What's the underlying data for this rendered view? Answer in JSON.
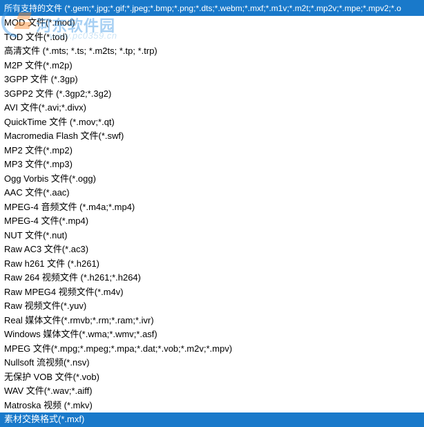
{
  "watermark": {
    "brand": "河东软件园",
    "url": "www.pc0359.cn"
  },
  "header": {
    "label": "所有支持的文件 (*.gem;*.jpg;*.gif;*.jpeg;*.bmp;*.png;*.dts;*.webm;*.mxf;*.m1v;*.m2t;*.mp2v;*.mpe;*.mpv2;*.o"
  },
  "filetypes": [
    {
      "label": "MOD 文件(*.mod)",
      "highlighted": false
    },
    {
      "label": "TOD 文件(*.tod)",
      "highlighted": false
    },
    {
      "label": "高清文件 (*.mts; *.ts; *.m2ts; *.tp; *.trp)",
      "highlighted": false
    },
    {
      "label": "M2P 文件(*.m2p)",
      "highlighted": false
    },
    {
      "label": "3GPP 文件 (*.3gp)",
      "highlighted": false
    },
    {
      "label": "3GPP2 文件 (*.3gp2;*.3g2)",
      "highlighted": false
    },
    {
      "label": "AVI 文件(*.avi;*.divx)",
      "highlighted": false
    },
    {
      "label": "QuickTime 文件 (*.mov;*.qt)",
      "highlighted": false
    },
    {
      "label": "Macromedia Flash 文件(*.swf)",
      "highlighted": false
    },
    {
      "label": "MP2 文件(*.mp2)",
      "highlighted": false
    },
    {
      "label": "MP3 文件(*.mp3)",
      "highlighted": false
    },
    {
      "label": "Ogg  Vorbis 文件(*.ogg)",
      "highlighted": false
    },
    {
      "label": "AAC 文件(*.aac)",
      "highlighted": false
    },
    {
      "label": "MPEG-4 音频文件 (*.m4a;*.mp4)",
      "highlighted": false
    },
    {
      "label": "MPEG-4 文件(*.mp4)",
      "highlighted": false
    },
    {
      "label": "NUT 文件(*.nut)",
      "highlighted": false
    },
    {
      "label": "Raw AC3 文件(*.ac3)",
      "highlighted": false
    },
    {
      "label": "Raw h261 文件 (*.h261)",
      "highlighted": false
    },
    {
      "label": "Raw 264 视频文件 (*.h261;*.h264)",
      "highlighted": false
    },
    {
      "label": "Raw MPEG4 视频文件(*.m4v)",
      "highlighted": false
    },
    {
      "label": "Raw 视频文件(*.yuv)",
      "highlighted": false
    },
    {
      "label": "Real 媒体文件(*.rmvb;*.rm;*.ram;*.ivr)",
      "highlighted": false
    },
    {
      "label": "Windows 媒体文件(*.wma;*.wmv;*.asf)",
      "highlighted": false
    },
    {
      "label": "MPEG 文件(*.mpg;*.mpeg;*.mpa;*.dat;*.vob;*.m2v;*.mpv)",
      "highlighted": false
    },
    {
      "label": "Nullsoft 流视频(*.nsv)",
      "highlighted": false
    },
    {
      "label": "无保护 VOB 文件(*.vob)",
      "highlighted": false
    },
    {
      "label": "WAV 文件(*.wav;*.aiff)",
      "highlighted": false
    },
    {
      "label": "Matroska 视频 (*.mkv)",
      "highlighted": false
    },
    {
      "label": "素材交换格式(*.mxf)",
      "highlighted": true
    }
  ]
}
